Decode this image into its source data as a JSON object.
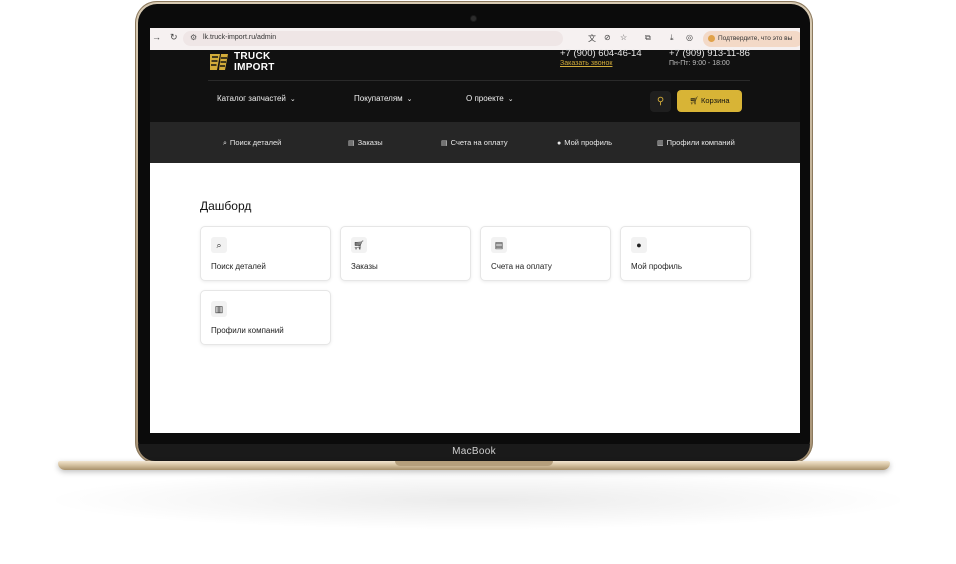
{
  "device": {
    "brand": "MacBook"
  },
  "browser": {
    "url": "lk.truck-import.ru/admin",
    "confirm_text": "Подтвердите, что это вы",
    "icons": {
      "back": "arrow-right-icon",
      "reload": "reload-icon",
      "site": "settings-icon",
      "translate": "translate-icon",
      "eye_off": "eye-off-icon",
      "star": "star-icon",
      "extensions": "puzzle-icon",
      "download": "download-icon",
      "share": "share-icon"
    }
  },
  "site": {
    "logo_line1": "TRUCK",
    "logo_line2": "IMPORT",
    "phone1": "+7 (900) 604-46-14",
    "callback": "Заказать звонок",
    "phone2": "+7 (909) 913-11-86",
    "hours": "Пн-Пт: 9:00 - 18:00",
    "menu": [
      {
        "label": "Каталог запчастей"
      },
      {
        "label": "Покупателям"
      },
      {
        "label": "О проекте"
      }
    ],
    "cart_label": "Корзина",
    "accent_color": "#d8b436"
  },
  "account_nav": [
    {
      "label": "Поиск деталей",
      "icon": "search-icon"
    },
    {
      "label": "Заказы",
      "icon": "document-icon"
    },
    {
      "label": "Счета на оплату",
      "icon": "document-icon"
    },
    {
      "label": "Мой профиль",
      "icon": "user-icon"
    },
    {
      "label": "Профили компаний",
      "icon": "building-icon"
    }
  ],
  "dashboard": {
    "title": "Дашборд",
    "cards": [
      {
        "label": "Поиск деталей",
        "icon": "search-icon"
      },
      {
        "label": "Заказы",
        "icon": "cart-icon"
      },
      {
        "label": "Счета на оплату",
        "icon": "document-icon"
      },
      {
        "label": "Мой профиль",
        "icon": "user-icon"
      },
      {
        "label": "Профили компаний",
        "icon": "building-icon"
      }
    ]
  }
}
